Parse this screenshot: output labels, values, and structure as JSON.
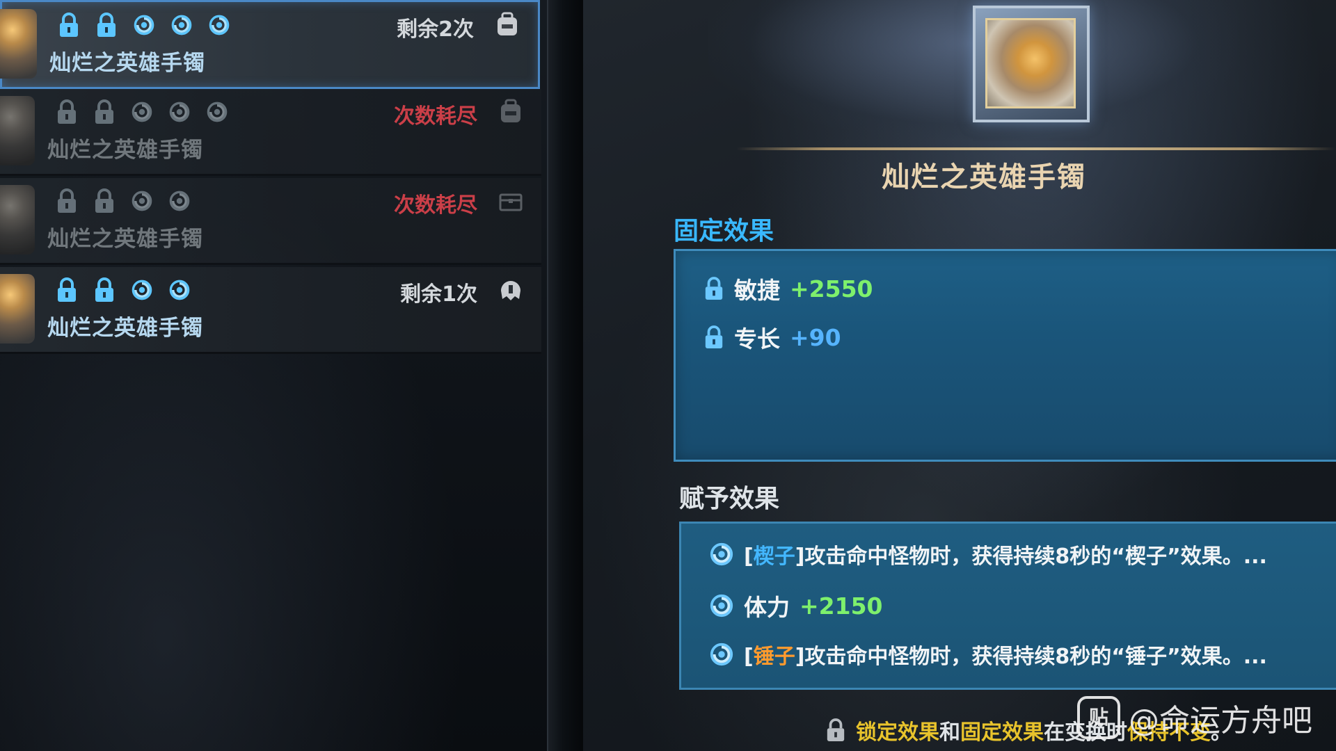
{
  "list": {
    "items": [
      {
        "name": "灿烂之英雄手镯",
        "status": "剩余2次",
        "status_type": "remaining",
        "selected": true,
        "icons": [
          "lock-icon",
          "lock-icon",
          "swirl-icon",
          "swirl-icon",
          "swirl-icon"
        ]
      },
      {
        "name": "灿烂之英雄手镯",
        "status": "次数耗尽",
        "status_type": "exhausted",
        "selected": false,
        "icons": [
          "lock-icon",
          "lock-icon",
          "swirl-icon",
          "swirl-icon",
          "swirl-icon"
        ]
      },
      {
        "name": "灿烂之英雄手镯",
        "status": "次数耗尽",
        "status_type": "exhausted",
        "selected": false,
        "icons": [
          "lock-icon",
          "lock-icon",
          "swirl-icon",
          "swirl-icon"
        ]
      },
      {
        "name": "灿烂之英雄手镯",
        "status": "剩余1次",
        "status_type": "remaining",
        "selected": false,
        "icons": [
          "lock-icon",
          "lock-icon",
          "swirl-icon",
          "swirl-icon"
        ]
      }
    ]
  },
  "detail": {
    "title": "灿烂之英雄手镯",
    "fixed_section": "固定效果",
    "fixed_effects": [
      {
        "name": "敏捷",
        "value": "+2550",
        "color": "green"
      },
      {
        "name": "专长",
        "value": "+90",
        "color": "blue"
      }
    ],
    "granted_section": "赋予效果",
    "granted_effects": [
      {
        "open": "[",
        "keyword": "楔子",
        "close": "]",
        "text": "攻击命中怪物时，获得持续8秒的“楔子”效果。...",
        "kw_color": "blue"
      },
      {
        "name": "体力",
        "value": "+2150"
      },
      {
        "open": "[",
        "keyword": "锤子",
        "close": "]",
        "text": "攻击命中怪物时，获得持续8秒的“锤子”效果。...",
        "kw_color": "orange"
      }
    ],
    "footer": {
      "part1": "锁定效果",
      "part2": "和",
      "part3": "固定效果",
      "part4": "在变换时",
      "part5": "保持不变",
      "part6": "。"
    }
  },
  "watermark": {
    "logo": "贴",
    "text": "@命运方舟吧"
  },
  "colors": {
    "accent_blue": "#39b8ff",
    "selected_border": "#4a88c6",
    "exhausted_red": "#ff4b55",
    "value_green": "#7ef06c",
    "note_yellow": "#e8c32c"
  }
}
